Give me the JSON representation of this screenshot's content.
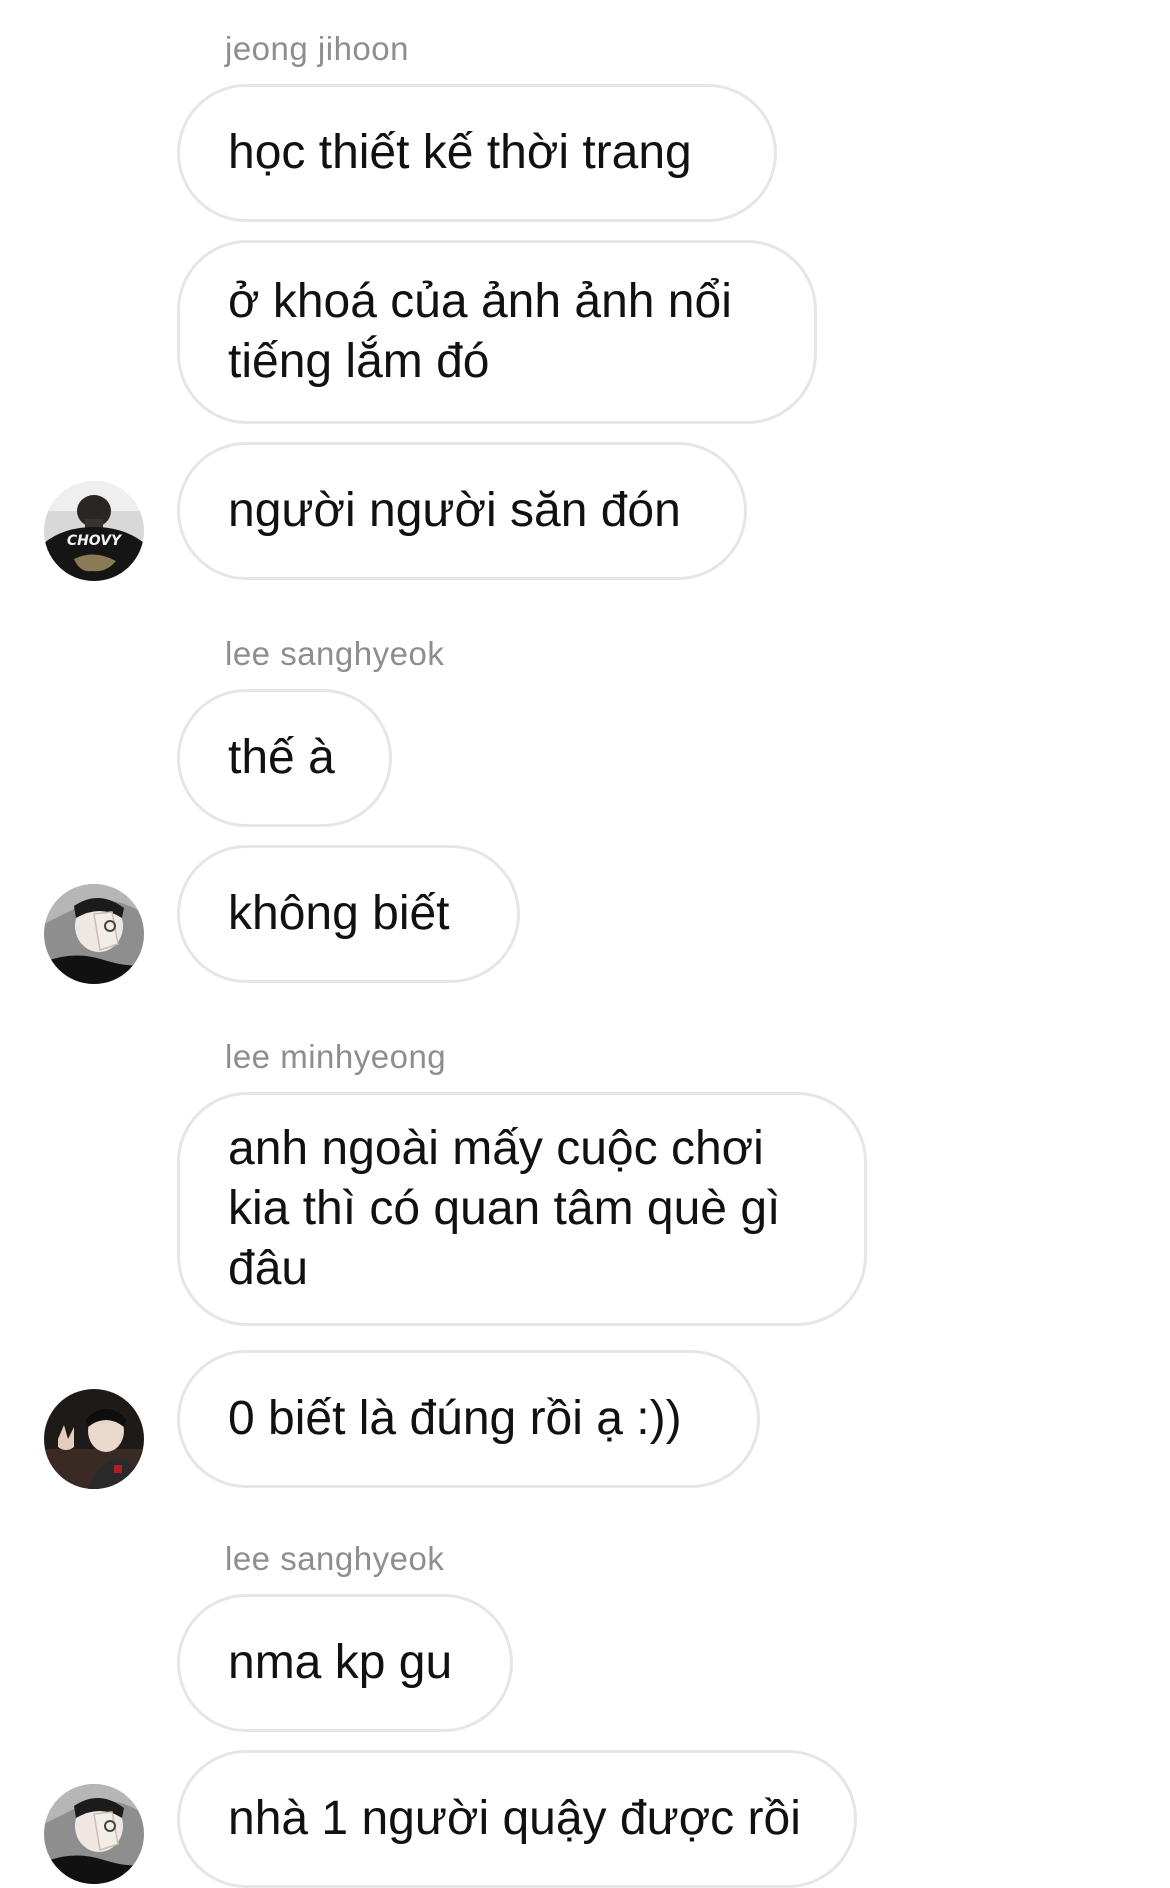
{
  "groups": [
    {
      "sender": "jeong jihoon",
      "avatar": "user-avatar-chovy-shirt",
      "messages": [
        "học thiết kế thời trang",
        "ở khoá của ảnh ảnh nổi\ntiếng lắm đó",
        "người người săn đón"
      ],
      "avatar_text": "CHOVY"
    },
    {
      "sender": "lee sanghyeok",
      "avatar": "user-avatar-hand-face",
      "messages": [
        "thế à",
        "không biết"
      ]
    },
    {
      "sender": "lee minhyeong",
      "avatar": "user-avatar-peace-sign",
      "messages": [
        "anh ngoài mấy cuộc chơi\nkia thì có quan tâm què gì\nđâu",
        "0 biết là đúng rồi ạ :))"
      ]
    },
    {
      "sender": "lee sanghyeok",
      "avatar": "user-avatar-hand-face",
      "messages": [
        "nma kp gu",
        "nhà 1 người quậy được rồi"
      ]
    }
  ],
  "colors": {
    "background": "#ffffff",
    "bubble_border": "#e6e6e6",
    "text": "#111111",
    "sender_name": "#8e8e8e"
  }
}
